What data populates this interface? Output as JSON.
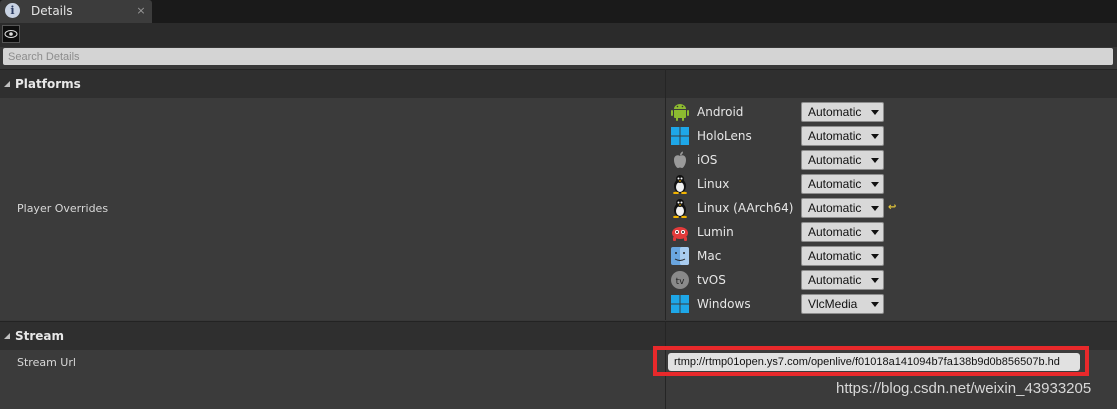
{
  "tab": {
    "title": "Details",
    "close": "×"
  },
  "search": {
    "placeholder": "Search Details"
  },
  "categories": {
    "platforms": "Platforms",
    "stream": "Stream"
  },
  "player_overrides": {
    "label": "Player Overrides",
    "platforms": [
      {
        "name": "Android",
        "value": "Automatic",
        "icon": "android-icon"
      },
      {
        "name": "HoloLens",
        "value": "Automatic",
        "icon": "windows-icon"
      },
      {
        "name": "iOS",
        "value": "Automatic",
        "icon": "apple-icon"
      },
      {
        "name": "Linux",
        "value": "Automatic",
        "icon": "linux-icon"
      },
      {
        "name": "Linux (AArch64)",
        "value": "Automatic",
        "icon": "linux-icon"
      },
      {
        "name": "Lumin",
        "value": "Automatic",
        "icon": "lumin-icon"
      },
      {
        "name": "Mac",
        "value": "Automatic",
        "icon": "mac-icon"
      },
      {
        "name": "tvOS",
        "value": "Automatic",
        "icon": "appletv-icon"
      },
      {
        "name": "Windows",
        "value": "VlcMedia",
        "icon": "windows-icon"
      }
    ]
  },
  "stream_url": {
    "label": "Stream Url",
    "value": "rtmp://rtmp01open.ys7.com/openlive/f01018a141094b7fa138b9d0b856507b.hd"
  },
  "watermark": "https://blog.csdn.net/weixin_43933205",
  "colors": {
    "highlight": "#e8292b",
    "reset": "#e0c33a"
  }
}
